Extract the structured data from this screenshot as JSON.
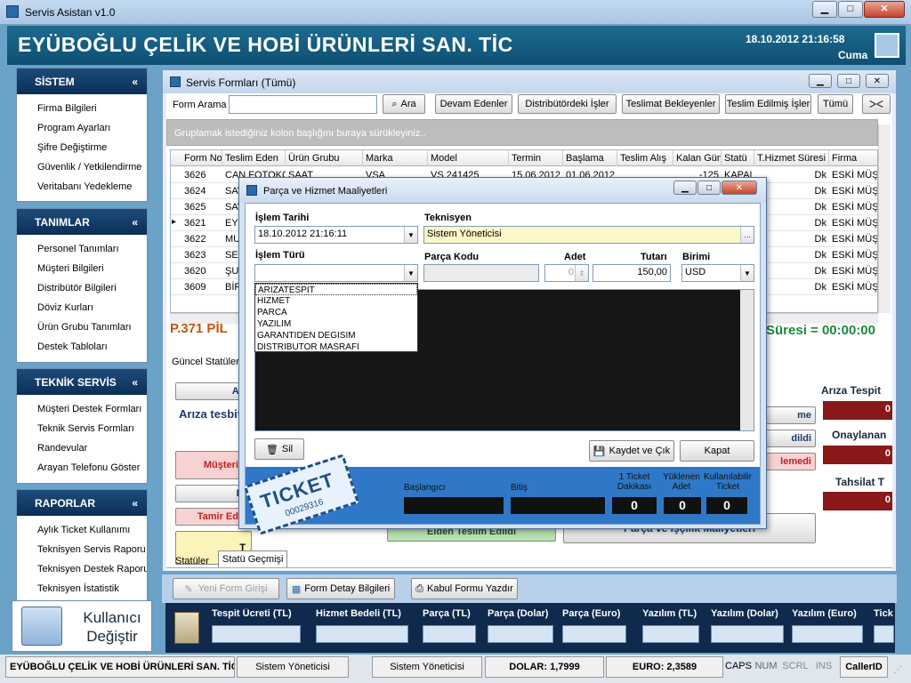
{
  "app": {
    "title": "Servis Asistan v1.0",
    "company": "EYÜBOĞLU ÇELİK VE HOBİ ÜRÜNLERİ SAN. TİC",
    "datetime": "18.10.2012 21:16:58",
    "day": "Cuma"
  },
  "sidebar": {
    "sistem": {
      "title": "SİSTEM",
      "items": [
        "Firma Bilgileri",
        "Program Ayarları",
        "Şifre Değiştirme",
        "Güvenlik / Yetkilendirme",
        "Veritabanı Yedekleme"
      ]
    },
    "tanimlar": {
      "title": "TANIMLAR",
      "items": [
        "Personel Tanımları",
        "Müşteri Bilgileri",
        "Distribütör Bilgileri",
        "Döviz Kurları",
        "Ürün Grubu Tanımları",
        "Destek Tabloları"
      ]
    },
    "teknik": {
      "title": "TEKNİK SERVİS",
      "items": [
        "Müşteri Destek Formları",
        "Teknik Servis Formları",
        "Randevular",
        "Arayan Telefonu Göster"
      ]
    },
    "raporlar": {
      "title": "RAPORLAR",
      "items": [
        "Aylık Ticket Kullanımı",
        "Teknisyen Servis Raporu",
        "Teknisyen Destek Raporu",
        "Teknisyen İstatistik"
      ]
    },
    "user_change": "Kullanıcı Değiştir"
  },
  "forms_window": {
    "title": "Servis Formları (Tümü)",
    "search_label": "Form Arama",
    "search_value": "",
    "search_button": "Ara",
    "filters": [
      "Devam Edenler",
      "Distribütördeki İşler",
      "Teslimat Bekleyenler",
      "Teslim Edilmiş İşler",
      "Tümü"
    ],
    "group_hint": "Gruplamak istediğiniz kolon başlığını buraya sürükleyiniz..",
    "columns": [
      "Form No",
      "Teslim Eden",
      "Ürün Grubu",
      "Marka",
      "Model",
      "Termin",
      "Başlama",
      "Teslim Alış",
      "Kalan Gün",
      "Statü",
      "T.Hizmet Süresi",
      "Firma"
    ],
    "rows": [
      [
        "3626",
        "CAN FOTOKO",
        "SAAT",
        "VSA",
        "VS 241425",
        "15.06.2012",
        "01.06.2012",
        "",
        "-125",
        "KAPALI",
        "Dk",
        "ESKİ MÜŞ"
      ],
      [
        "3624",
        "SAV",
        "",
        "",
        "",
        "",
        "",
        "",
        "",
        "",
        "Dk",
        "ESKİ MÜŞ"
      ],
      [
        "3625",
        "SAV",
        "",
        "",
        "",
        "",
        "",
        "",
        "",
        "",
        "Dk",
        "ESKİ MÜŞ"
      ],
      [
        "3621",
        "EYB",
        "",
        "",
        "",
        "",
        "",
        "",
        "",
        "",
        "Dk",
        "ESKİ MÜŞ"
      ],
      [
        "3622",
        "MUS",
        "",
        "",
        "",
        "",
        "",
        "",
        "",
        "",
        "Dk",
        "ESKİ MÜŞ"
      ],
      [
        "3623",
        "SERI",
        "",
        "",
        "",
        "",
        "",
        "",
        "",
        "",
        "Dk",
        "ESKİ MÜŞ"
      ],
      [
        "3620",
        "ŞUN",
        "",
        "",
        "",
        "",
        "",
        "",
        "",
        "",
        "Dk",
        "ESKİ MÜŞ"
      ],
      [
        "3609",
        "BİRİ",
        "",
        "",
        "",
        "",
        "",
        "",
        "",
        "",
        "Dk",
        "ESKİ MÜŞ"
      ]
    ],
    "form_label": "P.371 PİL",
    "service_time": "Süresi = 00:00:00",
    "status_tab": "Güncel Statüler",
    "left_labels": [
      "Arı",
      "Arıza tesbit",
      "Müşteri",
      "Pı",
      "Tamir Ed",
      "T"
    ],
    "right_labels": [
      "me",
      "dildi",
      "lemedi"
    ],
    "delivered": "Elden Teslim Edildi",
    "cost_button": "Parça ve İşçilik Maliyetleri",
    "counters": [
      {
        "label": "Arıza Tespit",
        "value": "0"
      },
      {
        "label": "Onaylanan",
        "value": "0"
      },
      {
        "label": "Tahsilat T",
        "value": "0"
      }
    ],
    "bottom_tabs": [
      "Statüler",
      "Statü Geçmişi"
    ],
    "actions": [
      "Yeni Form Girişi",
      "Form Detay Bilgileri",
      "Kabul Formu Yazdır"
    ],
    "totals": [
      "Tespit Ücreti (TL)",
      "Hizmet Bedeli (TL)",
      "Parça (TL)",
      "Parça (Dolar)",
      "Parça (Euro)",
      "Yazılım (TL)",
      "Yazılım (Dolar)",
      "Yazılım (Euro)",
      "Tick"
    ]
  },
  "dialog": {
    "title": "Parça ve Hizmet Maaliyetleri",
    "date_label": "İşlem Tarihi",
    "date_value": "18.10.2012 21:16:11",
    "tech_label": "Teknisyen",
    "tech_value": "Sistem Yöneticisi",
    "type_label": "İşlem Türü",
    "type_value": "",
    "part_label": "Parça Kodu",
    "qty_label": "Adet",
    "qty_value": "0",
    "amount_label": "Tutarı",
    "amount_value": "150,00",
    "unit_label": "Birimi",
    "unit_value": "USD",
    "options": [
      "ARIZATESPIT",
      "HIZMET",
      "PARCA",
      "YAZILIM",
      "GARANTIDEN DEGISIM",
      "DISTRIBUTOR MASRAFI"
    ],
    "delete_button": "Sil",
    "save_button": "Kaydet ve Çık",
    "close_button": "Kapat",
    "ticket": {
      "word": "TICKET",
      "number": "00029316",
      "start_label": "Başlangıcı",
      "end_label": "Bitiş",
      "minutes_label": "1 Ticket Dakikası",
      "minutes_value": "0",
      "loaded_label": "Yüklenen Adet",
      "loaded_value": "0",
      "usable_label": "Kullanılabilir Ticket",
      "usable_value": "0"
    }
  },
  "statusbar": {
    "company": "EYÜBOĞLU ÇELİK VE HOBİ ÜRÜNLERİ SAN. TİC",
    "user1": "Sistem Yöneticisi",
    "user2": "Sistem Yöneticisi",
    "usd": "DOLAR: 1,7999",
    "eur": "EURO: 2,3589",
    "caps": "CAPS",
    "num": "NUM",
    "scrl": "SCRL",
    "ins": "INS",
    "callerid": "CallerID"
  }
}
